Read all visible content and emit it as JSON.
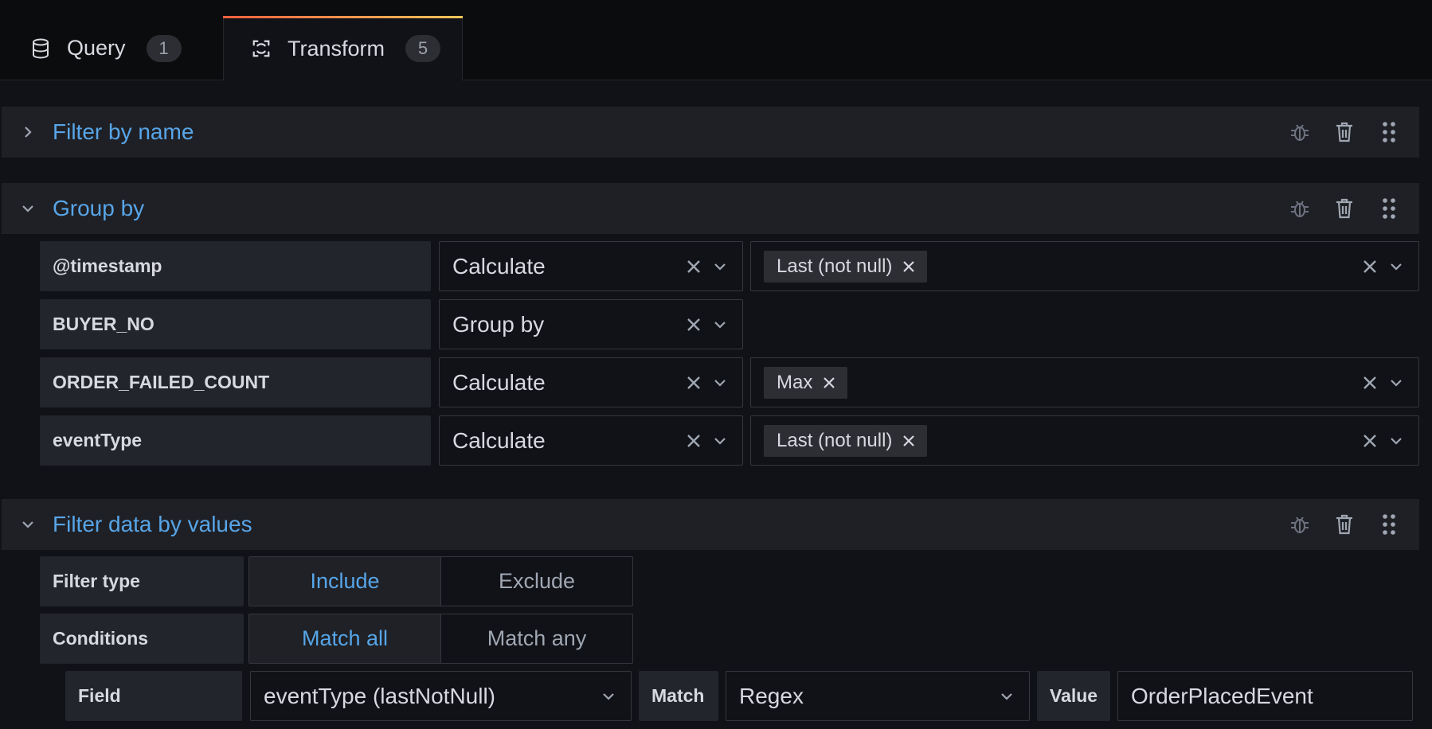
{
  "tabs": [
    {
      "label": "Query",
      "count": "1",
      "icon": "database-icon"
    },
    {
      "label": "Transform",
      "count": "5",
      "icon": "transform-icon"
    }
  ],
  "sections": {
    "filter_by_name": {
      "title": "Filter by name",
      "expanded": false
    },
    "group_by": {
      "title": "Group by",
      "expanded": true,
      "rows": [
        {
          "field": "@timestamp",
          "mode": "Calculate",
          "calcs": [
            "Last (not null)"
          ]
        },
        {
          "field": "BUYER_NO",
          "mode": "Group by",
          "calcs": []
        },
        {
          "field": "ORDER_FAILED_COUNT",
          "mode": "Calculate",
          "calcs": [
            "Max"
          ]
        },
        {
          "field": "eventType",
          "mode": "Calculate",
          "calcs": [
            "Last (not null)"
          ]
        }
      ]
    },
    "filter_data_by_values": {
      "title": "Filter data by values",
      "expanded": true,
      "filter_type_label": "Filter type",
      "filter_type_options": [
        "Include",
        "Exclude"
      ],
      "filter_type_selected": "Include",
      "conditions_label": "Conditions",
      "conditions_options": [
        "Match all",
        "Match any"
      ],
      "conditions_selected": "Match all",
      "condition": {
        "field_label": "Field",
        "field_value": "eventType (lastNotNull)",
        "match_label": "Match",
        "match_value": "Regex",
        "value_label": "Value",
        "value_value": "OrderPlacedEvent"
      }
    }
  },
  "colors": {
    "accent_blue": "#57a5e8",
    "tab_gradient_start": "#f55f3e",
    "tab_gradient_end": "#fbc55a",
    "background": "#111217",
    "panel": "#1f2025"
  }
}
